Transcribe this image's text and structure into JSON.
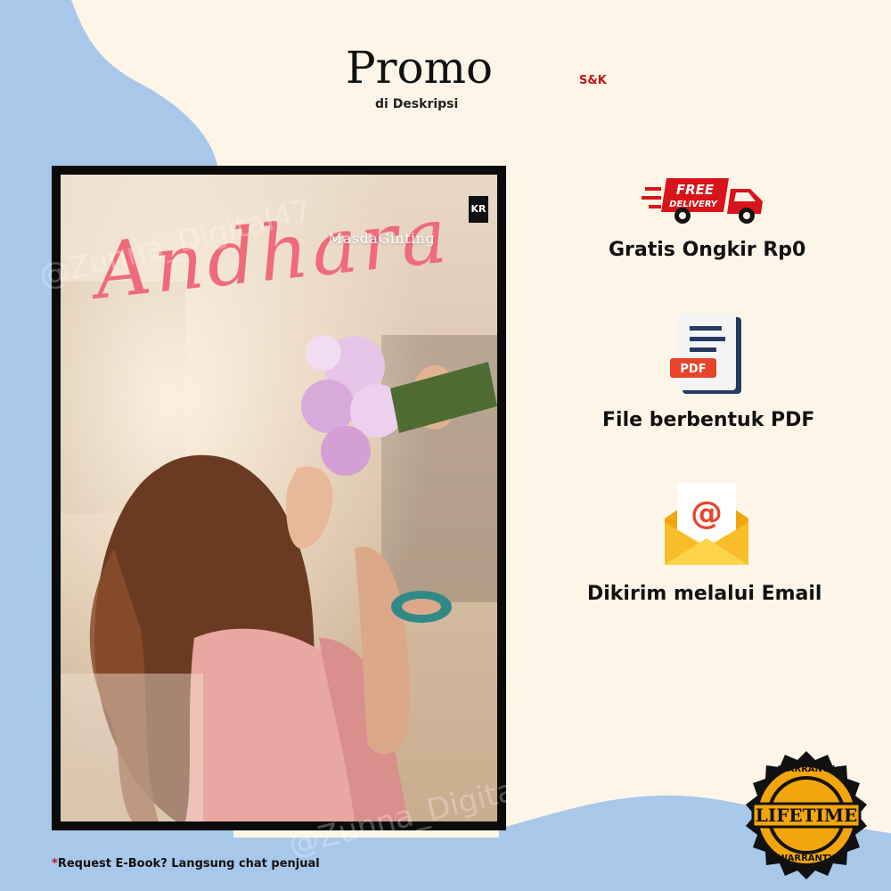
{
  "header": {
    "title": "Promo",
    "subtitle": "di Deskripsi",
    "terms": "S&K"
  },
  "cover": {
    "title": "Andhara",
    "author": "MasdaGinting",
    "publisher_logo": "KR",
    "watermark": "@Zunna_Digital47"
  },
  "features": [
    {
      "icon": "free-delivery-truck-icon",
      "label": "Gratis Ongkir Rp0",
      "icon_text": "FREE DELIVERY"
    },
    {
      "icon": "pdf-file-icon",
      "label": "File berbentuk PDF",
      "icon_text": "PDF"
    },
    {
      "icon": "email-envelope-icon",
      "label": "Dikirim melalui Email",
      "icon_text": "@"
    }
  ],
  "badge": {
    "top": "WARRANTY",
    "center": "LIFETIME",
    "bottom": "WARRANTY"
  },
  "footer": {
    "star": "*",
    "note": "Request E-Book? Langsung chat penjual"
  },
  "colors": {
    "background": "#fdf6e8",
    "blue_wave": "#a8c8ea",
    "accent_red": "#c0151a",
    "title_pink": "#ef6b7a",
    "badge_gold": "#f2a50c"
  }
}
